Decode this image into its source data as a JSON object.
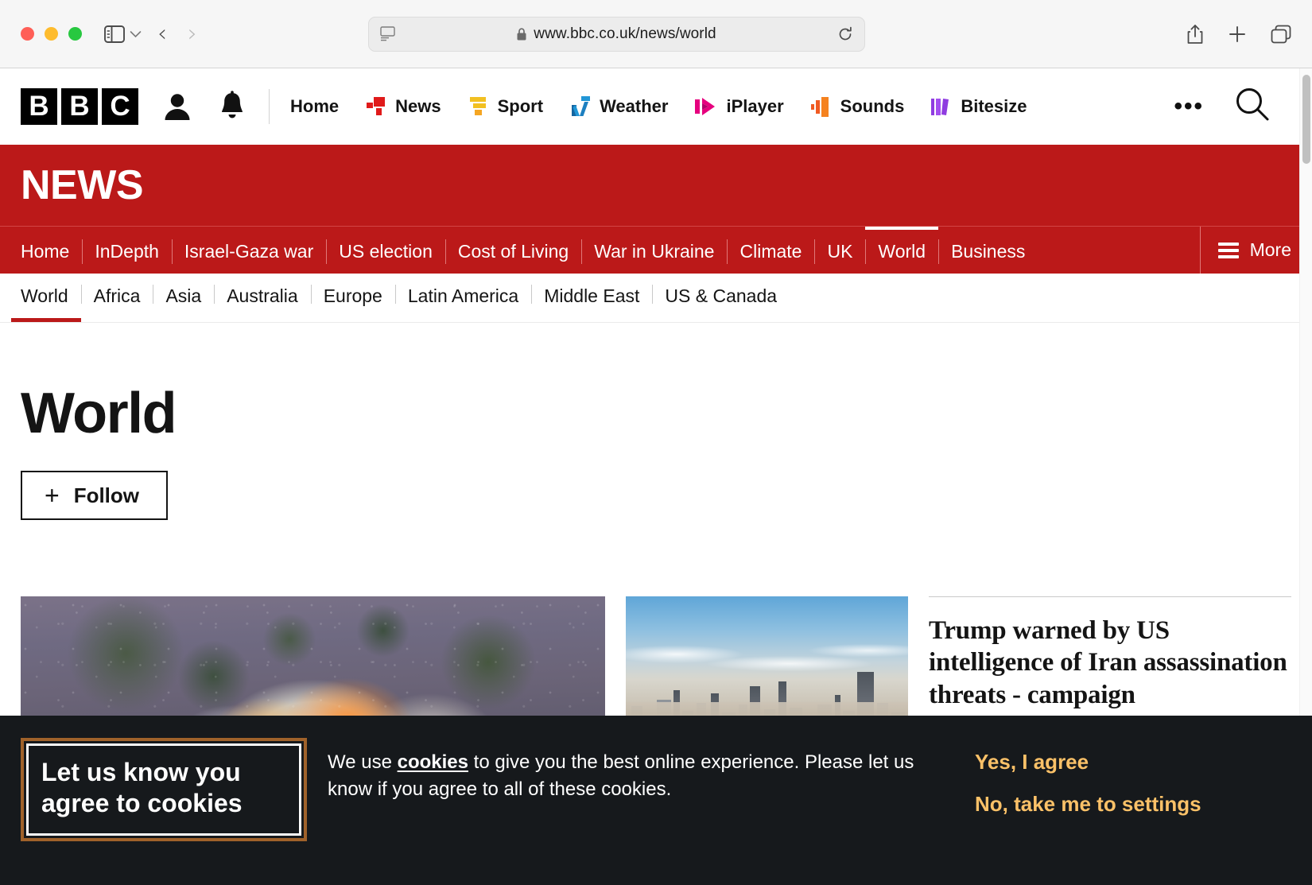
{
  "browser": {
    "url": "www.bbc.co.uk/news/world",
    "icons": {
      "sidebar": "sidebar-toggle-icon",
      "chevron": "chevron-down-icon",
      "back": "back-arrow-icon",
      "forward": "forward-arrow-icon",
      "reader": "reader-view-icon",
      "lock": "lock-icon",
      "reload": "reload-icon",
      "share": "share-icon",
      "newtab": "new-tab-icon",
      "tabs": "tab-overview-icon"
    }
  },
  "masthead": {
    "logo": [
      "B",
      "B",
      "C"
    ],
    "account_icon": "account-icon",
    "notifications_icon": "notifications-bell-icon",
    "links": [
      {
        "label": "Home",
        "icon": ""
      },
      {
        "label": "News",
        "icon": "news-icon"
      },
      {
        "label": "Sport",
        "icon": "sport-icon"
      },
      {
        "label": "Weather",
        "icon": "weather-icon"
      },
      {
        "label": "iPlayer",
        "icon": "iplayer-icon"
      },
      {
        "label": "Sounds",
        "icon": "sounds-icon"
      },
      {
        "label": "Bitesize",
        "icon": "bitesize-icon"
      }
    ],
    "more_icon": "more-dots-icon",
    "search_icon": "search-icon"
  },
  "banner": {
    "wordmark": "NEWS",
    "background": "#bb1919"
  },
  "section_nav": {
    "items": [
      {
        "label": "Home",
        "active": false
      },
      {
        "label": "InDepth",
        "active": false
      },
      {
        "label": "Israel-Gaza war",
        "active": false
      },
      {
        "label": "US election",
        "active": false
      },
      {
        "label": "Cost of Living",
        "active": false
      },
      {
        "label": "War in Ukraine",
        "active": false
      },
      {
        "label": "Climate",
        "active": false
      },
      {
        "label": "UK",
        "active": false
      },
      {
        "label": "World",
        "active": true
      },
      {
        "label": "Business",
        "active": false
      }
    ],
    "more_label": "More"
  },
  "sub_nav": {
    "items": [
      {
        "label": "World",
        "active": true
      },
      {
        "label": "Africa",
        "active": false
      },
      {
        "label": "Asia",
        "active": false
      },
      {
        "label": "Australia",
        "active": false
      },
      {
        "label": "Europe",
        "active": false
      },
      {
        "label": "Latin America",
        "active": false
      },
      {
        "label": "Middle East",
        "active": false
      },
      {
        "label": "US & Canada",
        "active": false
      }
    ]
  },
  "main": {
    "title": "World",
    "follow_label": "Follow",
    "follow_plus": "+"
  },
  "stories": [
    {
      "image": "explosion-hillside-photo",
      "headline": ""
    },
    {
      "image": "city-skyline-photo",
      "headline": ""
    },
    {
      "image": "",
      "headline": "Trump warned by US intelligence of Iran assassination threats - campaign"
    }
  ],
  "cookie_banner": {
    "heading": "Let us know you agree to cookies",
    "body_part1": "We use ",
    "body_link": "cookies",
    "body_part2": " to give you the best online experience. Please let us know if you agree to all of these cookies.",
    "agree_label": "Yes, I agree",
    "settings_label": "No, take me to settings",
    "link_color": "#fbc168",
    "background": "#16191c"
  }
}
